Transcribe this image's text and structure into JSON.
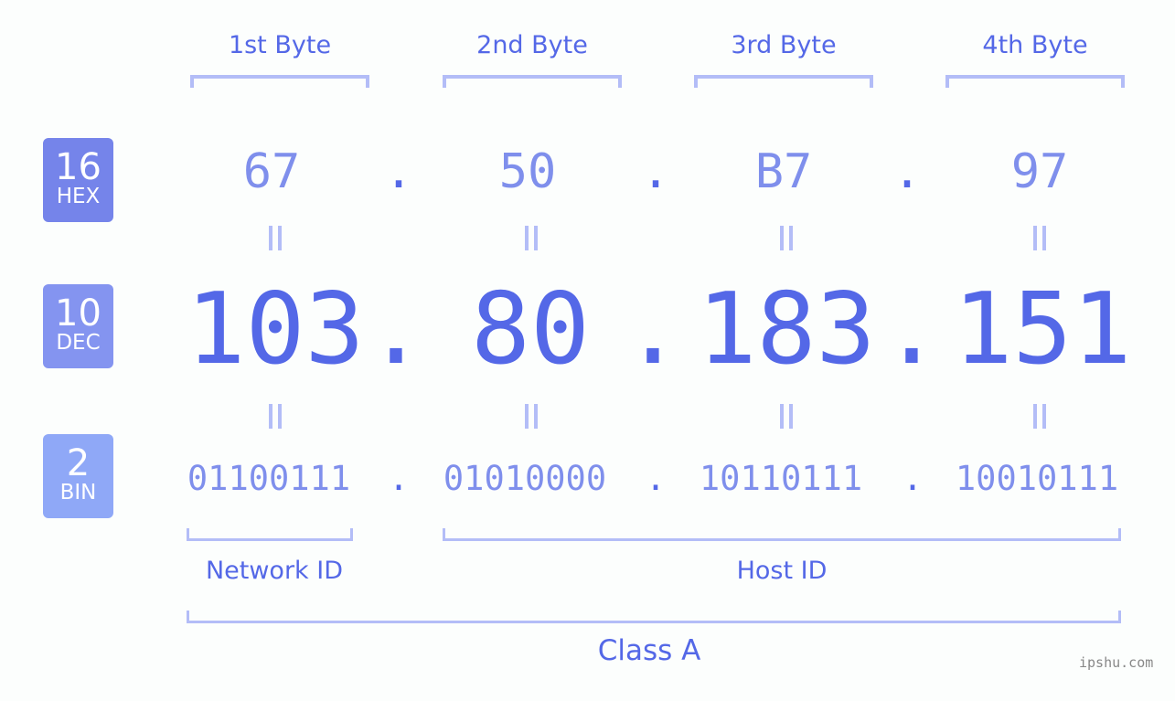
{
  "bytes": [
    {
      "label": "1st Byte",
      "hex": "67",
      "dec": "103",
      "bin": "01100111"
    },
    {
      "label": "2nd Byte",
      "hex": "50",
      "dec": "80",
      "bin": "01010000"
    },
    {
      "label": "3rd Byte",
      "hex": "B7",
      "dec": "183",
      "bin": "10110111"
    },
    {
      "label": "4th Byte",
      "hex": "97",
      "dec": "151",
      "bin": "10010111"
    }
  ],
  "separator": ".",
  "bases": {
    "hex": {
      "num": "16",
      "name": "HEX",
      "color": "#7584ea"
    },
    "dec": {
      "num": "10",
      "name": "DEC",
      "color": "#8494f0"
    },
    "bin": {
      "num": "2",
      "name": "BIN",
      "color": "#8fa8f7"
    }
  },
  "segments": {
    "network": "Network ID",
    "host": "Host ID",
    "class": "Class A"
  },
  "watermark": "ipshu.com",
  "colors": {
    "primary": "#5468e7",
    "light": "#7f8fec",
    "bracket": "#b3bdf7",
    "background": "#fcfefd"
  }
}
